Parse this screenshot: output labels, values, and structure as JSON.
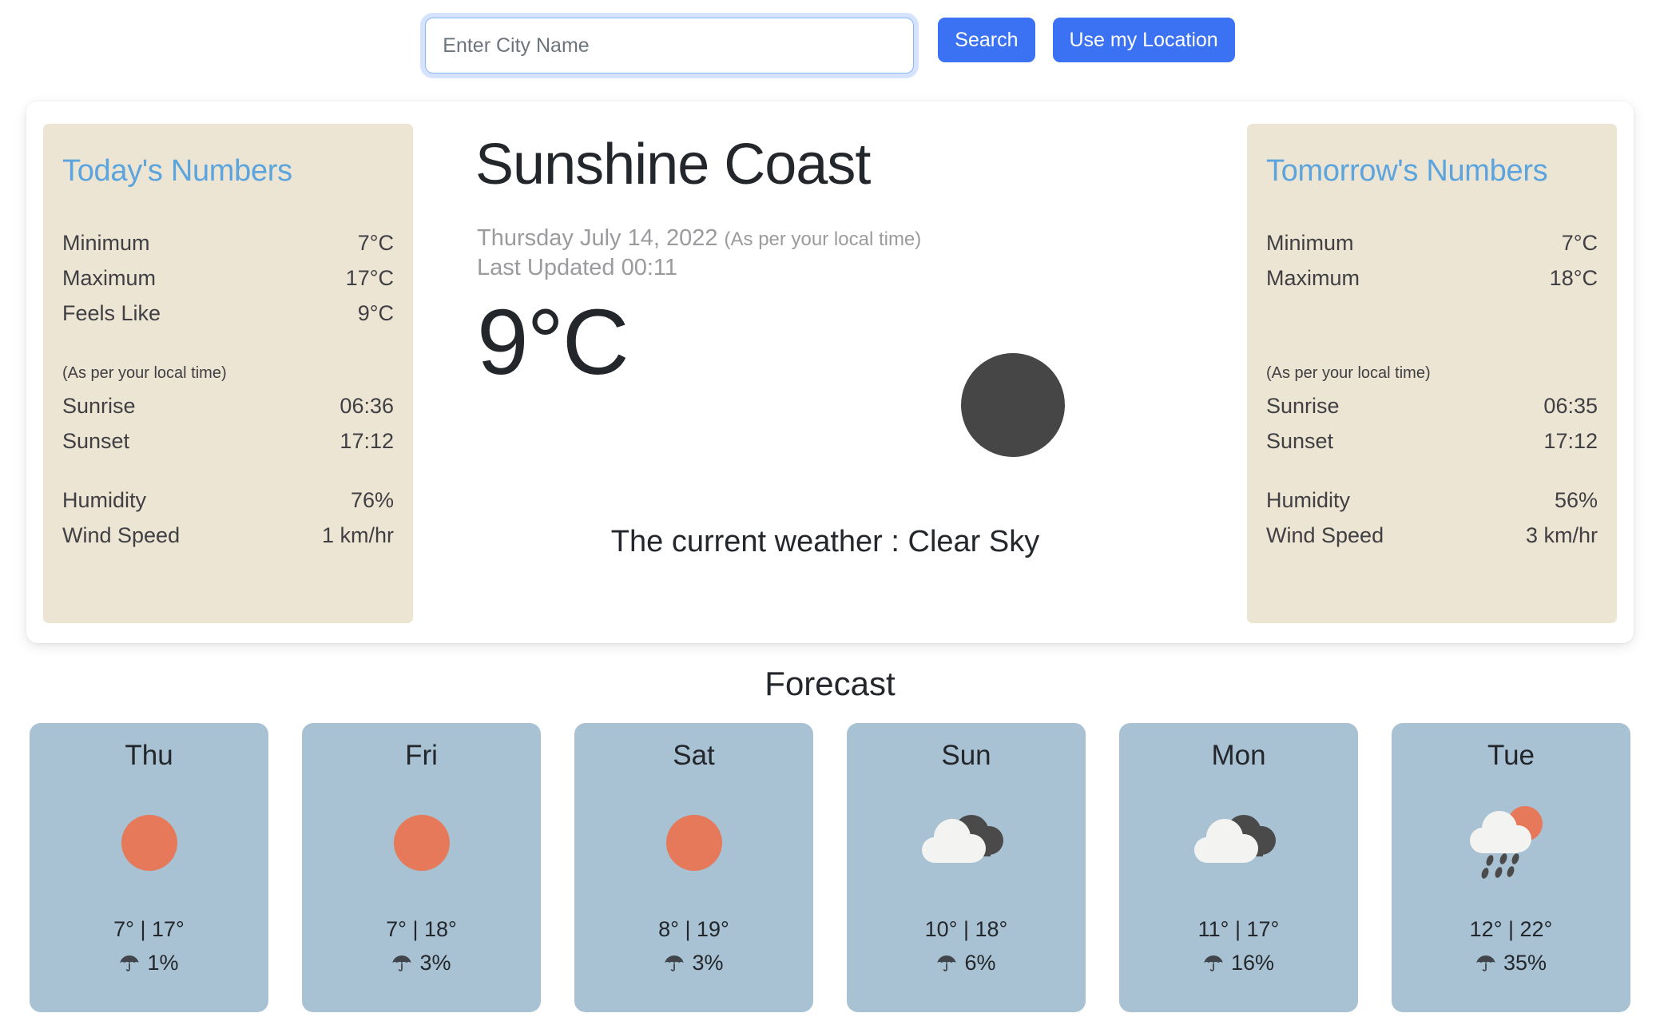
{
  "search": {
    "placeholder": "Enter City Name",
    "value": "",
    "search_label": "Search",
    "location_label": "Use my Location"
  },
  "today_panel": {
    "title": "Today's Numbers",
    "rows": [
      {
        "label": "Minimum",
        "value": "7°C"
      },
      {
        "label": "Maximum",
        "value": "17°C"
      },
      {
        "label": "Feels Like",
        "value": "9°C"
      }
    ],
    "note": "(As per your local time)",
    "sun_rows": [
      {
        "label": "Sunrise",
        "value": "06:36"
      },
      {
        "label": "Sunset",
        "value": "17:12"
      }
    ],
    "extra_rows": [
      {
        "label": "Humidity",
        "value": "76%"
      },
      {
        "label": "Wind Speed",
        "value": "1 km/hr"
      }
    ]
  },
  "tomorrow_panel": {
    "title": "Tomorrow's Numbers",
    "rows": [
      {
        "label": "Minimum",
        "value": "7°C"
      },
      {
        "label": "Maximum",
        "value": "18°C"
      }
    ],
    "note": "(As per your local time)",
    "sun_rows": [
      {
        "label": "Sunrise",
        "value": "06:35"
      },
      {
        "label": "Sunset",
        "value": "17:12"
      }
    ],
    "extra_rows": [
      {
        "label": "Humidity",
        "value": "56%"
      },
      {
        "label": "Wind Speed",
        "value": "3 km/hr"
      }
    ]
  },
  "current": {
    "city": "Sunshine Coast",
    "date": "Thursday July 14, 2022",
    "date_note": "(As per your local time)",
    "last_updated": "Last Updated 00:11",
    "temperature": "9°C",
    "description": "The current weather : Clear Sky",
    "icon": "moon-clear-icon"
  },
  "forecast": {
    "title": "Forecast",
    "days": [
      {
        "day": "Thu",
        "icon": "sun-icon",
        "temps": "7° | 17°",
        "precip": "1%"
      },
      {
        "day": "Fri",
        "icon": "sun-icon",
        "temps": "7° | 18°",
        "precip": "3%"
      },
      {
        "day": "Sat",
        "icon": "sun-icon",
        "temps": "8° | 19°",
        "precip": "3%"
      },
      {
        "day": "Sun",
        "icon": "clouds-icon",
        "temps": "10° | 18°",
        "precip": "6%"
      },
      {
        "day": "Mon",
        "icon": "clouds-icon",
        "temps": "11° | 17°",
        "precip": "16%"
      },
      {
        "day": "Tue",
        "icon": "sun-rain-cloud-icon",
        "temps": "12° | 22°",
        "precip": "35%"
      }
    ]
  },
  "colors": {
    "accent_blue": "#3b71f3",
    "panel_title_blue": "#5ba4dd",
    "panel_bg": "#ece5d3",
    "forecast_card_bg": "#a8c2d3",
    "sun_orange": "#e5795a",
    "moon_gray": "#464646",
    "cloud_white": "#f3f3f1",
    "cloud_dark": "#4a4a4a"
  }
}
